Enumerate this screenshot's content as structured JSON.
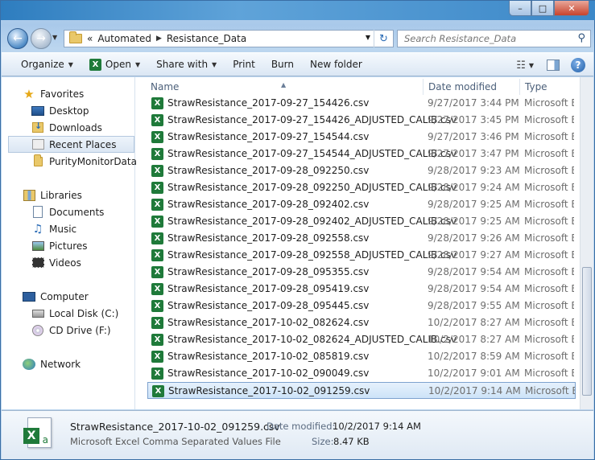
{
  "window": {
    "caption_buttons": {
      "minimize": "–",
      "maximize": "□",
      "close": "✕"
    }
  },
  "address": {
    "overflow": "«",
    "crumbs": [
      "Automated",
      "Resistance_Data"
    ],
    "separator": "▶"
  },
  "search": {
    "placeholder": "Search Resistance_Data"
  },
  "toolbar": {
    "organize": "Organize",
    "open": "Open",
    "share_with": "Share with",
    "print": "Print",
    "burn": "Burn",
    "new_folder": "New folder"
  },
  "nav": {
    "favorites": "Favorites",
    "desktop": "Desktop",
    "downloads": "Downloads",
    "recent_places": "Recent Places",
    "purity": "PurityMonitorData",
    "libraries": "Libraries",
    "documents": "Documents",
    "music": "Music",
    "pictures": "Pictures",
    "videos": "Videos",
    "computer": "Computer",
    "local_disk": "Local Disk (C:)",
    "cd_drive": "CD Drive (F:)",
    "network": "Network"
  },
  "columns": {
    "name": "Name",
    "date": "Date modified",
    "type": "Type"
  },
  "files": [
    {
      "name": "StrawResistance_2017-09-27_154426.csv",
      "date": "9/27/2017 3:44 PM",
      "type": "Microsoft Ex"
    },
    {
      "name": "StrawResistance_2017-09-27_154426_ADJUSTED_CALIB.csv",
      "date": "9/27/2017 3:45 PM",
      "type": "Microsoft Ex"
    },
    {
      "name": "StrawResistance_2017-09-27_154544.csv",
      "date": "9/27/2017 3:46 PM",
      "type": "Microsoft Ex"
    },
    {
      "name": "StrawResistance_2017-09-27_154544_ADJUSTED_CALIB.csv",
      "date": "9/27/2017 3:47 PM",
      "type": "Microsoft Ex"
    },
    {
      "name": "StrawResistance_2017-09-28_092250.csv",
      "date": "9/28/2017 9:23 AM",
      "type": "Microsoft Ex"
    },
    {
      "name": "StrawResistance_2017-09-28_092250_ADJUSTED_CALIB.csv",
      "date": "9/28/2017 9:24 AM",
      "type": "Microsoft Ex"
    },
    {
      "name": "StrawResistance_2017-09-28_092402.csv",
      "date": "9/28/2017 9:25 AM",
      "type": "Microsoft Ex"
    },
    {
      "name": "StrawResistance_2017-09-28_092402_ADJUSTED_CALIB.csv",
      "date": "9/28/2017 9:25 AM",
      "type": "Microsoft Ex"
    },
    {
      "name": "StrawResistance_2017-09-28_092558.csv",
      "date": "9/28/2017 9:26 AM",
      "type": "Microsoft Ex"
    },
    {
      "name": "StrawResistance_2017-09-28_092558_ADJUSTED_CALIB.csv",
      "date": "9/28/2017 9:27 AM",
      "type": "Microsoft Ex"
    },
    {
      "name": "StrawResistance_2017-09-28_095355.csv",
      "date": "9/28/2017 9:54 AM",
      "type": "Microsoft Ex"
    },
    {
      "name": "StrawResistance_2017-09-28_095419.csv",
      "date": "9/28/2017 9:54 AM",
      "type": "Microsoft Ex"
    },
    {
      "name": "StrawResistance_2017-09-28_095445.csv",
      "date": "9/28/2017 9:55 AM",
      "type": "Microsoft Ex"
    },
    {
      "name": "StrawResistance_2017-10-02_082624.csv",
      "date": "10/2/2017 8:27 AM",
      "type": "Microsoft Ex"
    },
    {
      "name": "StrawResistance_2017-10-02_082624_ADJUSTED_CALIB.csv",
      "date": "10/2/2017 8:27 AM",
      "type": "Microsoft Ex"
    },
    {
      "name": "StrawResistance_2017-10-02_085819.csv",
      "date": "10/2/2017 8:59 AM",
      "type": "Microsoft Ex"
    },
    {
      "name": "StrawResistance_2017-10-02_090049.csv",
      "date": "10/2/2017 9:01 AM",
      "type": "Microsoft Ex"
    },
    {
      "name": "StrawResistance_2017-10-02_091259.csv",
      "date": "10/2/2017 9:14 AM",
      "type": "Microsoft Ex"
    }
  ],
  "selected_index": 17,
  "details": {
    "name": "StrawResistance_2017-10-02_091259.csv",
    "type": "Microsoft Excel Comma Separated Values File",
    "date_label": "Date modified:",
    "date_value": "10/2/2017 9:14 AM",
    "size_label": "Size:",
    "size_value": "8.47 KB"
  },
  "colors": {
    "excel_green": "#1f7a3a",
    "selection": "#cde3f8",
    "selection_border": "#7da2ce",
    "toolbar_gradient_top": "#f5f9fd"
  },
  "icons": [
    "back-arrow-icon",
    "forward-arrow-icon",
    "folder-icon",
    "refresh-icon",
    "search-icon",
    "excel-icon",
    "views-icon",
    "preview-pane-icon",
    "help-icon",
    "star-icon",
    "desktop-icon",
    "downloads-icon",
    "recent-places-icon",
    "libraries-icon",
    "documents-icon",
    "music-icon",
    "pictures-icon",
    "videos-icon",
    "computer-icon",
    "local-disk-icon",
    "cd-drive-icon",
    "network-icon"
  ]
}
